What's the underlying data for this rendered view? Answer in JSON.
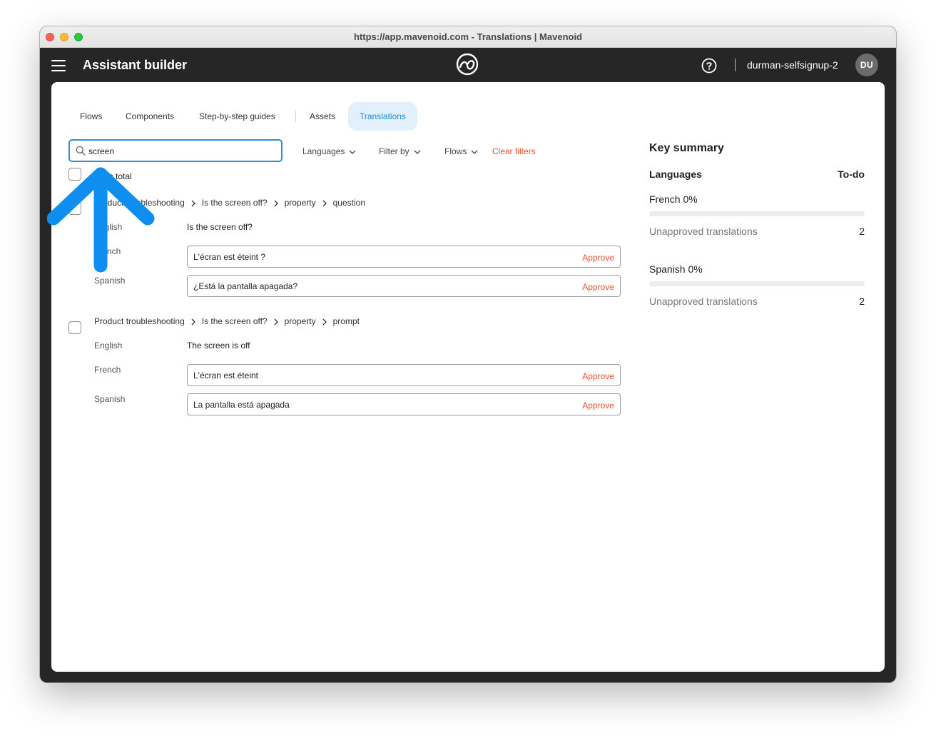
{
  "window": {
    "title": "https://app.mavenoid.com - Translations | Mavenoid"
  },
  "appbar": {
    "menu_icon": "hamburger-menu-icon",
    "title": "Assistant builder",
    "logo_icon": "mavenoid-logo-icon",
    "help_icon": "help-circle-icon",
    "account": "durman-selfsignup-2",
    "avatar_initials": "DU"
  },
  "tabs": [
    {
      "label": "Flows",
      "active": false
    },
    {
      "label": "Components",
      "active": false
    },
    {
      "label": "Step-by-step guides",
      "active": false
    },
    {
      "label": "Assets",
      "active": false
    },
    {
      "label": "Translations",
      "active": true
    }
  ],
  "toolbar": {
    "search_value": "screen",
    "filters": [
      "Languages",
      "Filter by",
      "Flows"
    ],
    "clear_filters": "Clear filters"
  },
  "list": {
    "total_label": "ys in total",
    "items": [
      {
        "breadcrumb": [
          "Product troubleshooting",
          "Is the screen off?",
          "property",
          "question"
        ],
        "english_label": "English",
        "source": "Is the screen off?",
        "translations": [
          {
            "language": "French",
            "value": "L'écran est éteint ?",
            "action": "Approve"
          },
          {
            "language": "Spanish",
            "value": "¿Está la pantalla apagada?",
            "action": "Approve"
          }
        ]
      },
      {
        "breadcrumb": [
          "Product troubleshooting",
          "Is the screen off?",
          "property",
          "prompt"
        ],
        "english_label": "English",
        "source": "The screen is off",
        "translations": [
          {
            "language": "French",
            "value": "L'écran est éteint",
            "action": "Approve"
          },
          {
            "language": "Spanish",
            "value": "La pantalla está apagada",
            "action": "Approve"
          }
        ]
      }
    ]
  },
  "summary": {
    "title": "Key summary",
    "col_languages": "Languages",
    "col_todo": "To-do",
    "languages": [
      {
        "name": "French 0%",
        "progress": 0,
        "row_label": "Unapproved translations",
        "count": "2"
      },
      {
        "name": "Spanish 0%",
        "progress": 0,
        "row_label": "Unapproved translations",
        "count": "2"
      }
    ]
  },
  "colors": {
    "accent": "#1d8fd8",
    "danger": "#ea4f2e",
    "annotation_arrow": "#0d8ef0"
  }
}
